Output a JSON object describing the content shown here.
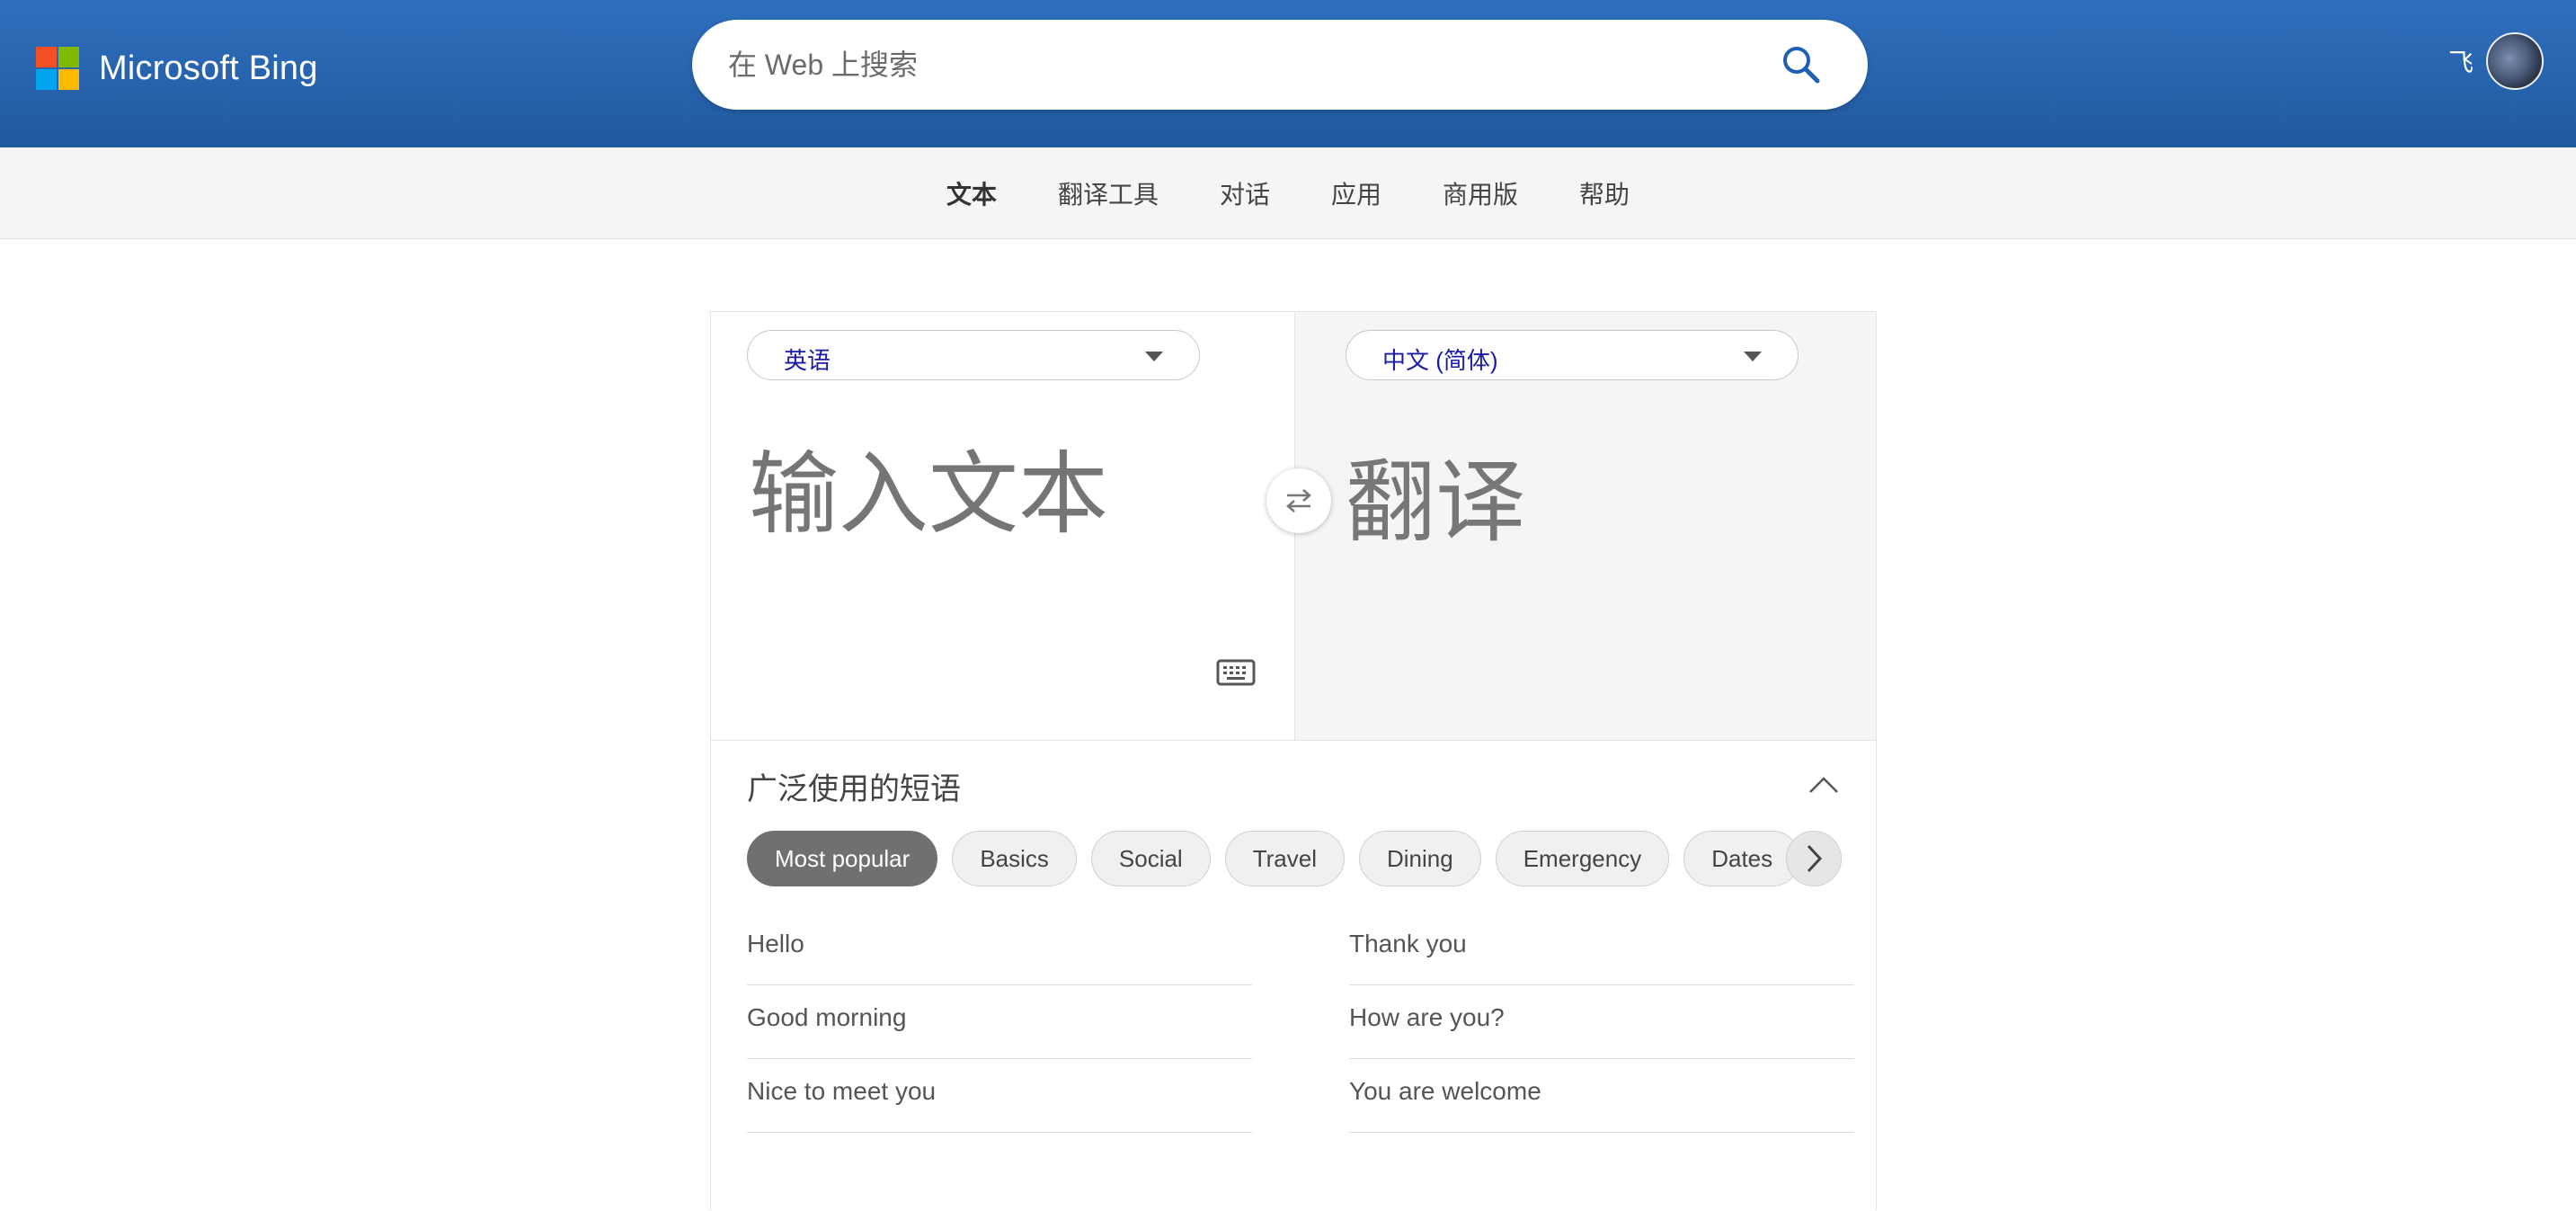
{
  "header": {
    "brand": "Microsoft Bing",
    "logo_colors": [
      "#f25022",
      "#7fba00",
      "#00a4ef",
      "#ffb900"
    ],
    "search_placeholder": "在 Web 上搜索",
    "search_icon": "search-icon",
    "user_name": "飞"
  },
  "nav": {
    "items": [
      {
        "label": "文本",
        "active": true
      },
      {
        "label": "翻译工具"
      },
      {
        "label": "对话"
      },
      {
        "label": "应用"
      },
      {
        "label": "商用版"
      },
      {
        "label": "帮助"
      }
    ]
  },
  "translator": {
    "source_lang": "英语",
    "target_lang": "中文 (简体)",
    "source_placeholder": "输入文本",
    "target_placeholder": "翻译",
    "swap_icon": "swap-arrows-icon",
    "keyboard_icon": "keyboard-icon"
  },
  "phrases": {
    "title": "广泛使用的短语",
    "categories": [
      {
        "label": "Most popular",
        "active": true
      },
      {
        "label": "Basics"
      },
      {
        "label": "Social"
      },
      {
        "label": "Travel"
      },
      {
        "label": "Dining"
      },
      {
        "label": "Emergency"
      },
      {
        "label": "Dates"
      }
    ],
    "left": [
      "Hello",
      "Good morning",
      "Nice to meet you"
    ],
    "right": [
      "Thank you",
      "How are you?",
      "You are welcome"
    ]
  },
  "colors": {
    "header_bg": "#2a65b0",
    "nav_bg": "#f5f5f5",
    "lang_text": "#1a1aa6",
    "chip_active": "#707070"
  }
}
